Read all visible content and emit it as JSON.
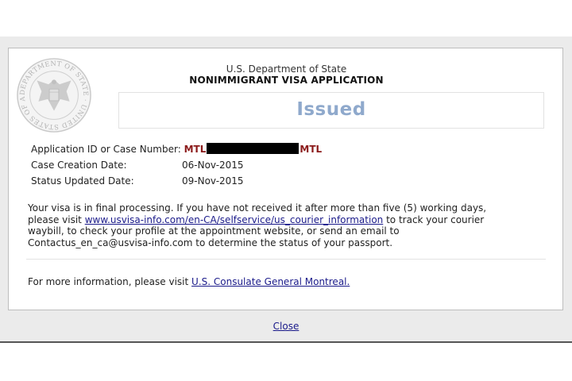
{
  "header": {
    "department": "U.S. Department of State",
    "title": "NONIMMIGRANT VISA APPLICATION",
    "seal_text": "DEPARTMENT OF STATE · UNITED STATES OF AMERICA"
  },
  "status": {
    "label": "Issued",
    "color": "#8fa9cc"
  },
  "details": {
    "application_id_label": "Application ID or Case Number:",
    "application_id_prefix": "MTL",
    "application_id_suffix": "MTL",
    "creation_label": "Case Creation Date:",
    "creation_value": "06-Nov-2015",
    "updated_label": "Status Updated Date:",
    "updated_value": "09-Nov-2015"
  },
  "message": {
    "line1": "Your visa is in final processing. If you have not received it after more than five (5) working days,",
    "line2_pre": "please visit ",
    "courier_link": "www.usvisa-info.com/en-CA/selfservice/us_courier_information",
    "line2_post": " to track your courier",
    "line3": "waybill, to check your profile at the appointment website, or send an email to",
    "line4": "Contactus_en_ca@usvisa-info.com to determine the status of your passport."
  },
  "more_info": {
    "pre": "For more information, please visit ",
    "link": "U.S. Consulate General Montreal."
  },
  "footer": {
    "close_label": "Close"
  }
}
